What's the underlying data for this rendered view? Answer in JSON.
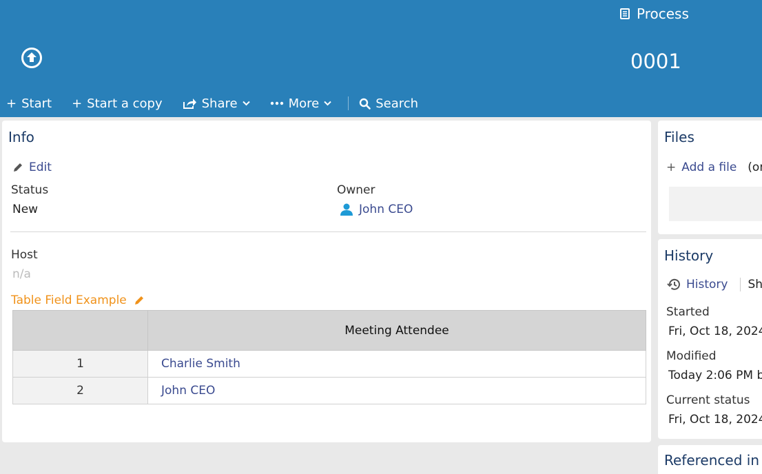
{
  "header": {
    "process_label": "Process",
    "record_number": "0001",
    "background_color": "#2980b9"
  },
  "toolbar": {
    "start_label": "Start",
    "start_copy_label": "Start a copy",
    "share_label": "Share",
    "more_label": "More",
    "search_label": "Search"
  },
  "info": {
    "title": "Info",
    "edit_label": "Edit",
    "status_label": "Status",
    "status_value": "New",
    "owner_label": "Owner",
    "owner_value": "John CEO",
    "host_label": "Host",
    "host_value": "n/a",
    "table_title": "Table Field Example",
    "table": {
      "columns": [
        "",
        "Meeting Attendee"
      ],
      "rows": [
        {
          "index": "1",
          "attendee": "Charlie Smith"
        },
        {
          "index": "2",
          "attendee": "John CEO"
        }
      ]
    }
  },
  "files": {
    "title": "Files",
    "add_file_label": "Add a file",
    "trailing_text": "(or"
  },
  "history": {
    "title": "History",
    "history_link": "History",
    "show_text": "Sho",
    "started_label": "Started",
    "started_value": "Fri, Oct 18, 2024",
    "modified_label": "Modified",
    "modified_value": "Today 2:06 PM b",
    "current_status_label": "Current status",
    "current_status_value": "Fri, Oct 18, 2024"
  },
  "referenced": {
    "title": "Referenced in"
  },
  "colors": {
    "accent_orange": "#f0921a",
    "link_blue": "#3a4a8f",
    "title_navy": "#1b3a66",
    "person_icon": "#1e9ad6"
  }
}
